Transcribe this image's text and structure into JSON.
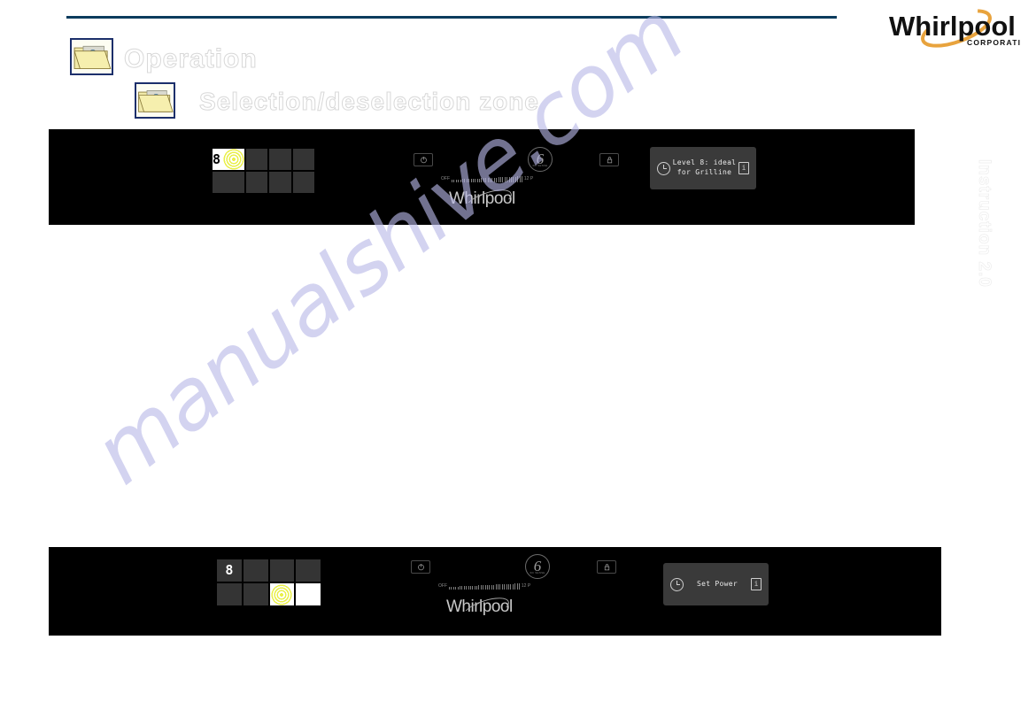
{
  "document": {
    "side_tab_label": "Instruction 2.0",
    "watermark": "manualshive.com"
  },
  "brand": {
    "logo_word": "Whirlpool",
    "logo_sub": "CORPORATION",
    "panel_wordmark": "Whirlpool"
  },
  "headings": {
    "operation": "Operation",
    "selection": "Selection/deselection zone"
  },
  "panels": [
    {
      "id": "panel-top",
      "zone_grid": {
        "rows": 2,
        "cols": 4,
        "cells": [
          {
            "active": true,
            "digit": "8",
            "rings": true
          },
          {
            "active": false,
            "digit": "",
            "rings": false
          },
          {
            "active": false,
            "digit": "",
            "rings": false
          },
          {
            "active": false,
            "digit": "",
            "rings": false
          },
          {
            "active": false,
            "digit": "",
            "rings": false
          },
          {
            "active": false,
            "digit": "",
            "rings": false
          },
          {
            "active": false,
            "digit": "",
            "rings": false
          },
          {
            "active": false,
            "digit": "",
            "rings": false
          }
        ]
      },
      "controls": {
        "power_label": "power-button",
        "sense_label": "6",
        "sense_sub": "6th SENSE",
        "lock_label": "lock-button"
      },
      "slider": {
        "min_label": "OFF",
        "max_label": "12 P",
        "ticks": 34
      },
      "display": {
        "text": "Level 8: ideal\nfor Grilline",
        "info_glyph": "i"
      }
    },
    {
      "id": "panel-bottom",
      "zone_grid": {
        "rows": 2,
        "cols": 4,
        "cells": [
          {
            "active": false,
            "digit": "8",
            "rings": false
          },
          {
            "active": false,
            "digit": "",
            "rings": false
          },
          {
            "active": false,
            "digit": "",
            "rings": false
          },
          {
            "active": false,
            "digit": "",
            "rings": false
          },
          {
            "active": false,
            "digit": "",
            "rings": false
          },
          {
            "active": false,
            "digit": "",
            "rings": false
          },
          {
            "active": true,
            "digit": "",
            "rings": true
          },
          {
            "active": true,
            "digit": "",
            "rings": false
          }
        ]
      },
      "controls": {
        "power_label": "power-button",
        "sense_label": "6",
        "sense_sub": "6th SENSE",
        "lock_label": "lock-button"
      },
      "slider": {
        "min_label": "OFF",
        "max_label": "12 P",
        "ticks": 34
      },
      "display": {
        "text": "Set Power",
        "info_glyph": "i"
      }
    }
  ],
  "colors": {
    "rule": "#0b3c5d",
    "panel_bg": "#000000",
    "zone_cell": "#343434",
    "zone_active": "#ffffff",
    "ring": "#e9ef4a",
    "lcd_bg": "#3a3a3a",
    "lcd_text": "#e8e8e8",
    "logo_swoosh": "#e8a33d",
    "watermark": "#b9b9e8"
  }
}
